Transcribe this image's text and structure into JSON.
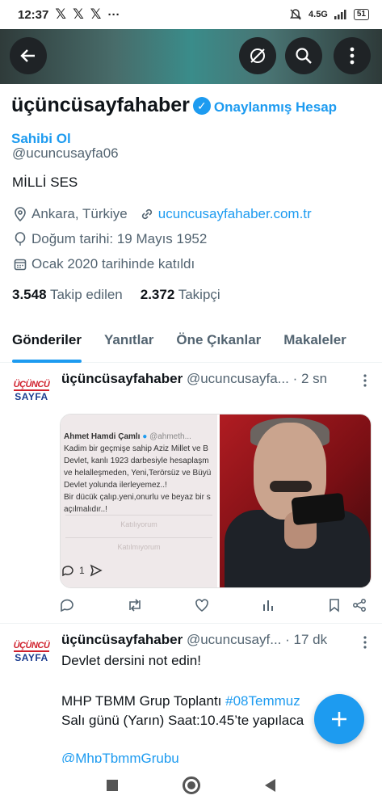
{
  "status_bar": {
    "time": "12:37",
    "x_icons": [
      "𝕏",
      "𝕏",
      "𝕏"
    ],
    "more": "···",
    "network": "4.5G",
    "battery": "51"
  },
  "profile": {
    "display_name": "üçüncüsayfahaber",
    "verified_label_1": "Onaylanmış Hesap",
    "verified_label_2": "Sahibi Ol",
    "handle": "@ucuncusayfa06",
    "bio": "MİLLİ SES",
    "location": "Ankara, Türkiye",
    "website": "ucuncusayfahaber.com.tr",
    "birthday": "Doğum tarihi: 19 Mayıs 1952",
    "joined": "Ocak 2020 tarihinde katıldı",
    "following_count": "3.548",
    "following_label": "Takip edilen",
    "followers_count": "2.372",
    "followers_label": "Takipçi"
  },
  "tabs": [
    {
      "label": "Gönderiler",
      "active": true
    },
    {
      "label": "Yanıtlar",
      "active": false
    },
    {
      "label": "Öne Çıkanlar",
      "active": false
    },
    {
      "label": "Makaleler",
      "active": false
    }
  ],
  "avatar": {
    "top": "ÜÇÜNCÜ",
    "bottom": "SAYFA"
  },
  "tweets": [
    {
      "name": "üçüncüsayfahaber",
      "handle": "@ucuncusayfa...",
      "time": "· 2 sn",
      "embedded": {
        "author": "Ahmet Hamdi Çamlı",
        "author_handle": "@ahmeth...",
        "lines": [
          "Kadim bir geçmişe sahip Aziz Millet ve B",
          "Devlet, kanlı 1923 darbesiyle hesaplaşm",
          "ve helalleşmeden, Yeni,Terörsüz ve Büyü",
          "Devlet yolunda ilerleyemez..!",
          "Bir dücük çalıp.yeni,onurlu ve beyaz bir s",
          "açılmalıdır..!"
        ],
        "button_1": "Katılıyorum",
        "button_2": "Katılmıyorum",
        "reply_count": "1"
      }
    },
    {
      "name": "üçüncüsayfahaber",
      "handle": "@ucuncusayf...",
      "time": "· 17 dk",
      "line_1": "Devlet dersini not edin!",
      "line_2_prefix": "MHP TBMM Grup Toplantı ",
      "line_2_hashtag": "#08Temmuz",
      "line_3": "Salı günü (Yarın) Saat:10.45’te yapılaca",
      "line_4": "@MhpTbmmGrubu"
    }
  ],
  "colors": {
    "accent": "#1d9bf0",
    "text": "#0f1419",
    "muted": "#536471"
  }
}
